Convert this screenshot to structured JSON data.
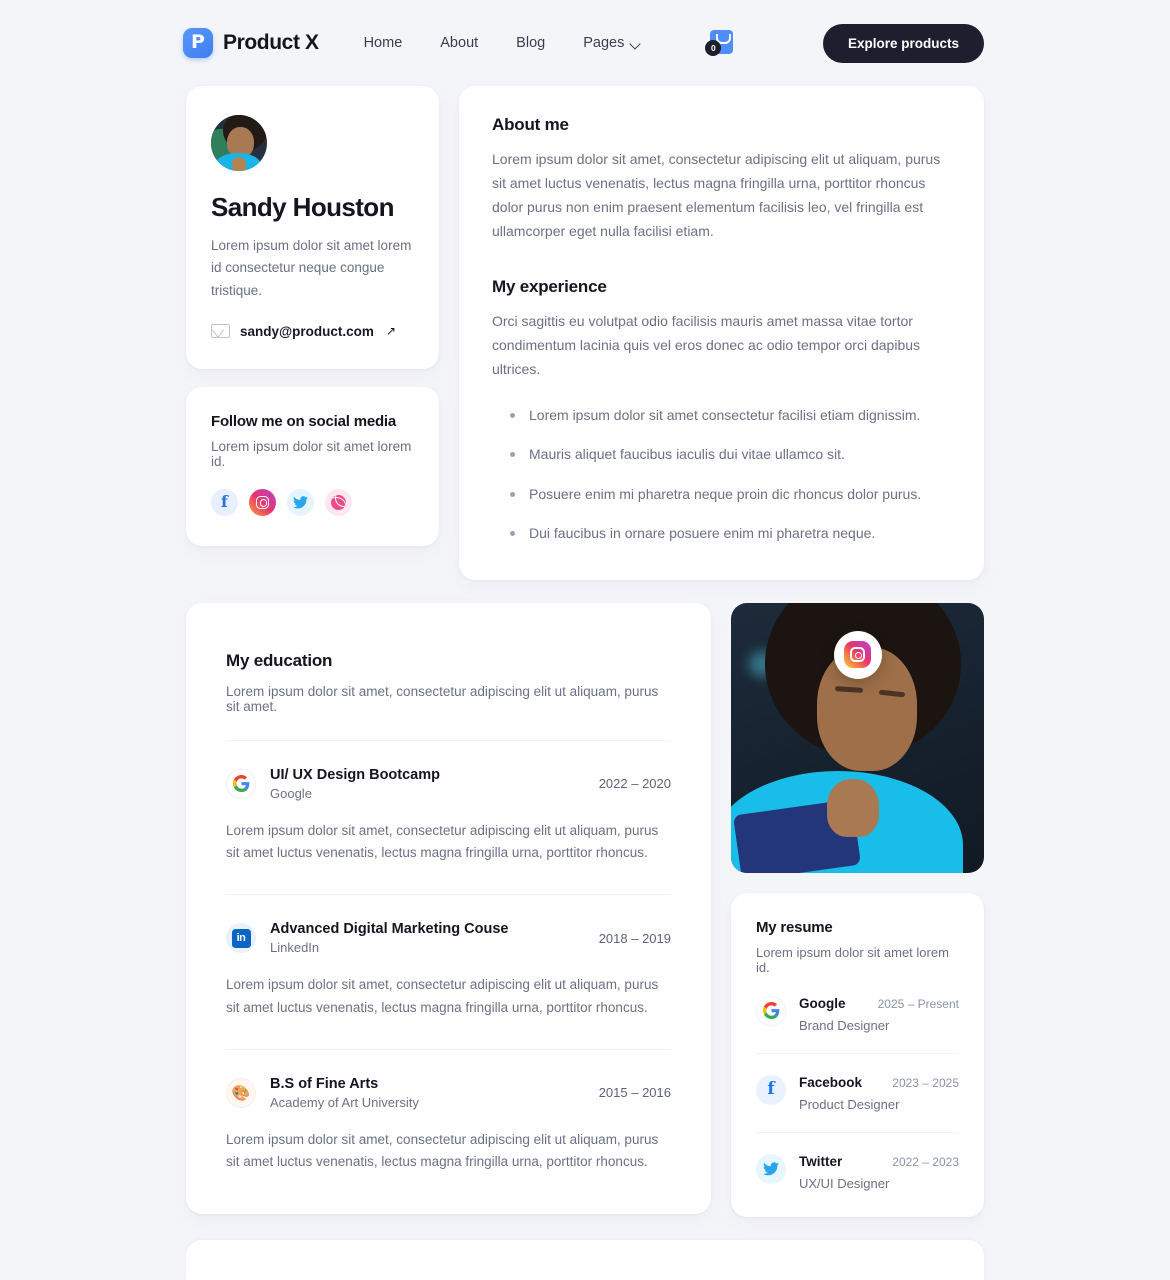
{
  "brand": {
    "name": "Product X",
    "logo_letter": "P",
    "logo_color": "#4f8dfb"
  },
  "nav": {
    "links": [
      {
        "label": "Home"
      },
      {
        "label": "About"
      },
      {
        "label": "Blog"
      },
      {
        "label": "Pages",
        "has_dropdown": true
      }
    ],
    "cart": {
      "icon": "shopping-bag-icon",
      "count": "0"
    },
    "cta_label": "Explore products"
  },
  "profile": {
    "avatar_alt": "Sandy Houston portrait",
    "name": "Sandy Houston",
    "bio": "Lorem ipsum dolor sit amet lorem id consectetur neque congue tristique.",
    "email": "sandy@product.com",
    "email_icon": "envelope-icon",
    "external_arrow": "↗"
  },
  "social": {
    "title": "Follow me on social media",
    "subtitle": "Lorem ipsum dolor sit amet lorem id.",
    "icons": [
      {
        "name": "facebook-icon",
        "glyph": "f",
        "color": "#2a71e8"
      },
      {
        "name": "instagram-icon",
        "glyph": "",
        "color": "#e6366e"
      },
      {
        "name": "twitter-icon",
        "glyph": "✉",
        "color": "#2aa6ef"
      },
      {
        "name": "dribbble-icon",
        "glyph": "",
        "color": "#ea4c89"
      }
    ]
  },
  "about": {
    "title": "About me",
    "text": "Lorem ipsum dolor sit amet, consectetur adipiscing elit ut aliquam, purus sit amet luctus venenatis, lectus magna fringilla urna, porttitor rhoncus dolor purus non enim praesent elementum facilisis leo, vel fringilla est ullamcorper eget nulla facilisi etiam.",
    "experience_title": "My experience",
    "experience_text": "Orci sagittis eu volutpat odio facilisis mauris amet massa vitae tortor condimentum lacinia quis vel eros donec ac odio tempor orci dapibus ultrices.",
    "bullets": [
      "Lorem ipsum dolor sit amet consectetur facilisi etiam dignissim.",
      "Mauris aliquet faucibus iaculis dui vitae ullamco sit.",
      "Posuere enim mi pharetra neque proin dic rhoncus dolor purus.",
      "Dui faucibus in ornare posuere enim mi pharetra neque."
    ]
  },
  "education": {
    "title": "My education",
    "subtitle": "Lorem ipsum dolor sit amet, consectetur adipiscing elit ut aliquam, purus sit amet.",
    "items": [
      {
        "logo": "google-logo-icon",
        "title": "UI/ UX Design Bootcamp",
        "org": "Google",
        "dates": "2022 – 2020",
        "desc": "Lorem ipsum dolor sit amet, consectetur adipiscing elit ut aliquam, purus sit amet luctus venenatis, lectus magna fringilla urna, porttitor rhoncus."
      },
      {
        "logo": "linkedin-logo-icon",
        "title": "Advanced Digital Marketing Couse",
        "org": "LinkedIn",
        "dates": "2018 – 2019",
        "desc": "Lorem ipsum dolor sit amet, consectetur adipiscing elit ut aliquam, purus sit amet luctus venenatis, lectus magna fringilla urna, porttitor rhoncus."
      },
      {
        "logo": "art-palette-icon",
        "title": "B.S of Fine Arts",
        "org": "Academy of Art University",
        "dates": "2015 – 2016",
        "desc": "Lorem ipsum dolor sit amet, consectetur adipiscing elit ut aliquam, purus sit amet luctus venenatis, lectus magna fringilla urna, porttitor rhoncus."
      }
    ]
  },
  "photo": {
    "alt": "Woman in blue top working on a tablet",
    "badge_icon": "instagram-icon"
  },
  "resume": {
    "title": "My resume",
    "subtitle": "Lorem ipsum dolor sit amet lorem id.",
    "items": [
      {
        "logo": "google-logo-icon",
        "company": "Google",
        "dates": "2025 – Present",
        "role": "Brand Designer"
      },
      {
        "logo": "facebook-logo-icon",
        "company": "Facebook",
        "dates": "2023 – 2025",
        "role": "Product Designer"
      },
      {
        "logo": "twitter-logo-icon",
        "company": "Twitter",
        "dates": "2022 – 2023",
        "role": "UX/UI Designer"
      }
    ]
  }
}
